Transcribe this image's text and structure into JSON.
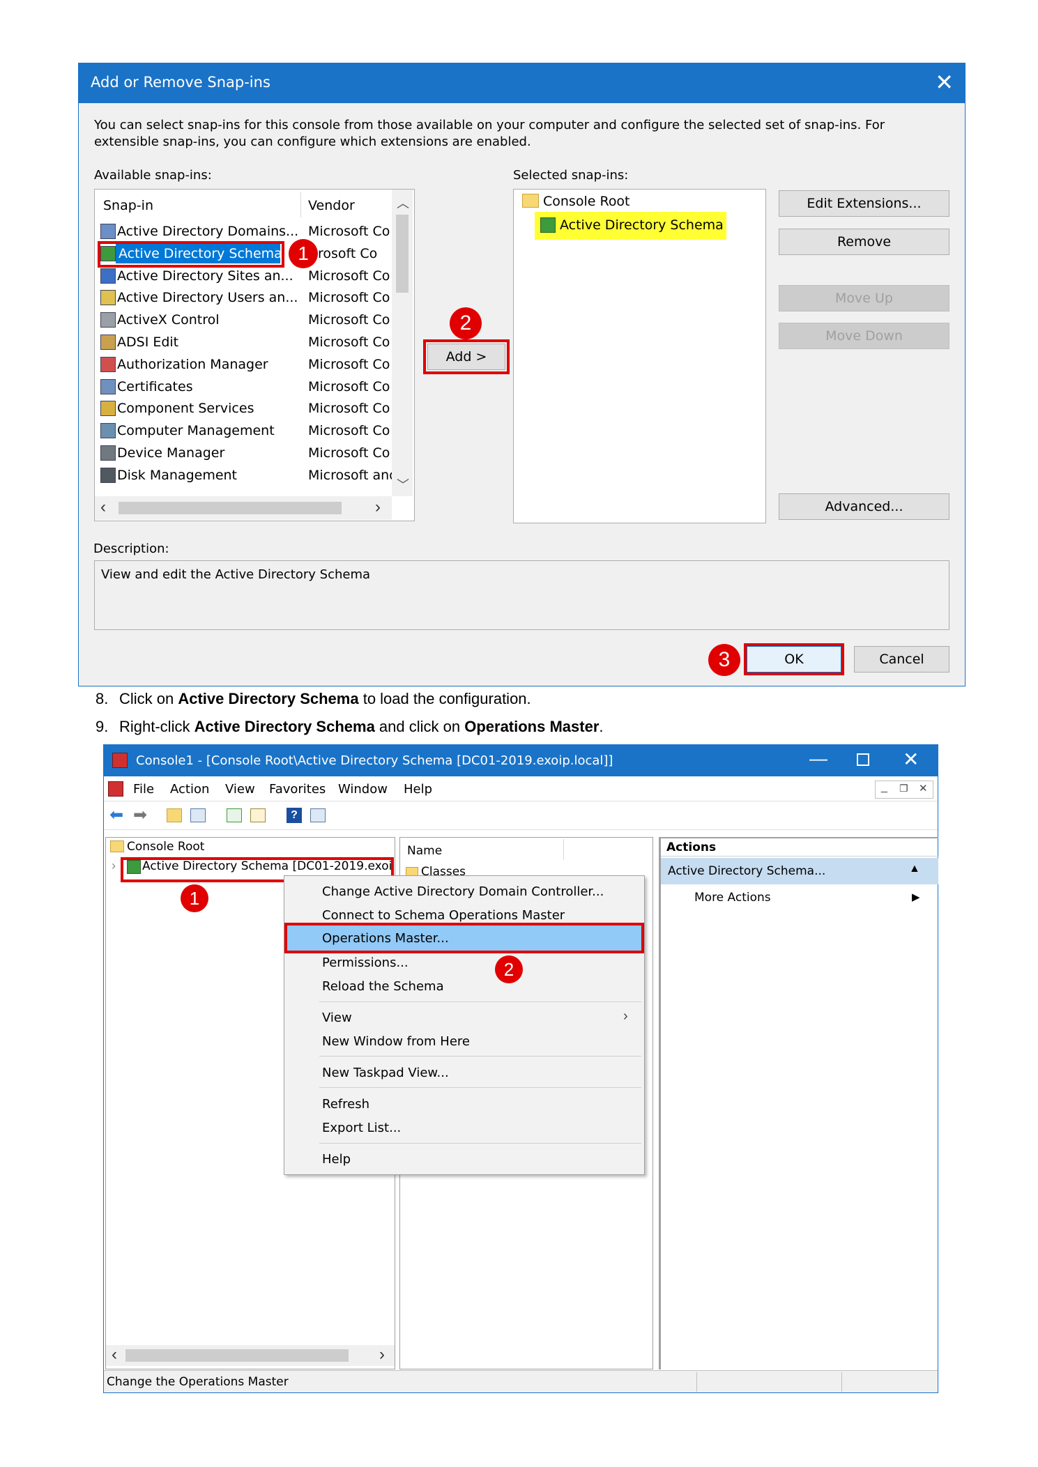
{
  "dialog": {
    "title": "Add or Remove Snap-ins",
    "intro_line1": "You can select snap-ins for this console from those available on your computer and configure the selected set of snap-ins. For",
    "intro_line2": "extensible snap-ins, you can configure which extensions are enabled.",
    "available_label": "Available snap-ins:",
    "selected_label": "Selected snap-ins:",
    "columns": {
      "snapin": "Snap-in",
      "vendor": "Vendor"
    },
    "snapins": [
      {
        "name": "Active Directory Domains...",
        "vendor": "Microsoft Co"
      },
      {
        "name": "Active Directory Schema",
        "vendor": "rosoft Co"
      },
      {
        "name": "Active Directory Sites an...",
        "vendor": "Microsoft Co"
      },
      {
        "name": "Active Directory Users an...",
        "vendor": "Microsoft Co"
      },
      {
        "name": "ActiveX Control",
        "vendor": "Microsoft Co"
      },
      {
        "name": "ADSI Edit",
        "vendor": "Microsoft Co"
      },
      {
        "name": "Authorization Manager",
        "vendor": "Microsoft Co"
      },
      {
        "name": "Certificates",
        "vendor": "Microsoft Co"
      },
      {
        "name": "Component Services",
        "vendor": "Microsoft Co"
      },
      {
        "name": "Computer Management",
        "vendor": "Microsoft Co"
      },
      {
        "name": "Device Manager",
        "vendor": "Microsoft Co"
      },
      {
        "name": "Disk Management",
        "vendor": "Microsoft and"
      }
    ],
    "selected_tree": {
      "root": "Console Root",
      "child": "Active Directory Schema"
    },
    "buttons": {
      "add": "Add >",
      "edit_extensions": "Edit Extensions...",
      "remove": "Remove",
      "move_up": "Move Up",
      "move_down": "Move Down",
      "advanced": "Advanced...",
      "ok": "OK",
      "cancel": "Cancel"
    },
    "description_label": "Description:",
    "description_text": "View and edit the Active Directory Schema",
    "badges": [
      "1",
      "2",
      "3"
    ],
    "colors": {
      "titlebar": "#1a73c7",
      "selection": "#0078d7",
      "highlight": "#ffff33",
      "annotation": "#e00000"
    }
  },
  "steps": [
    {
      "num": "8.",
      "pre": "Click on ",
      "b1": "Active Directory Schema",
      "mid": " to load the configuration.",
      "b2": "",
      "post": ""
    },
    {
      "num": "9.",
      "pre": "Right-click ",
      "b1": "Active Directory Schema",
      "mid": " and click on ",
      "b2": "Operations Master",
      "post": "."
    }
  ],
  "console": {
    "title": "Console1 - [Console Root\\Active Directory Schema [DC01-2019.exoip.local]]",
    "menu": [
      "File",
      "Action",
      "View",
      "Favorites",
      "Window",
      "Help"
    ],
    "tree": {
      "root": "Console Root",
      "child": "Active Directory Schema [DC01-2019.exoi"
    },
    "list_header": "Name",
    "list_item": "Classes",
    "actions": {
      "header": "Actions",
      "group": "Active Directory Schema...",
      "more": "More Actions"
    },
    "context_menu": [
      "Change Active Directory Domain Controller...",
      "Connect to Schema Operations Master",
      "Operations Master...",
      "Permissions...",
      "Reload the Schema",
      "View",
      "New Window from Here",
      "New Taskpad View...",
      "Refresh",
      "Export List...",
      "Help"
    ],
    "status": "Change the Operations Master",
    "badges": [
      "1",
      "2"
    ]
  }
}
